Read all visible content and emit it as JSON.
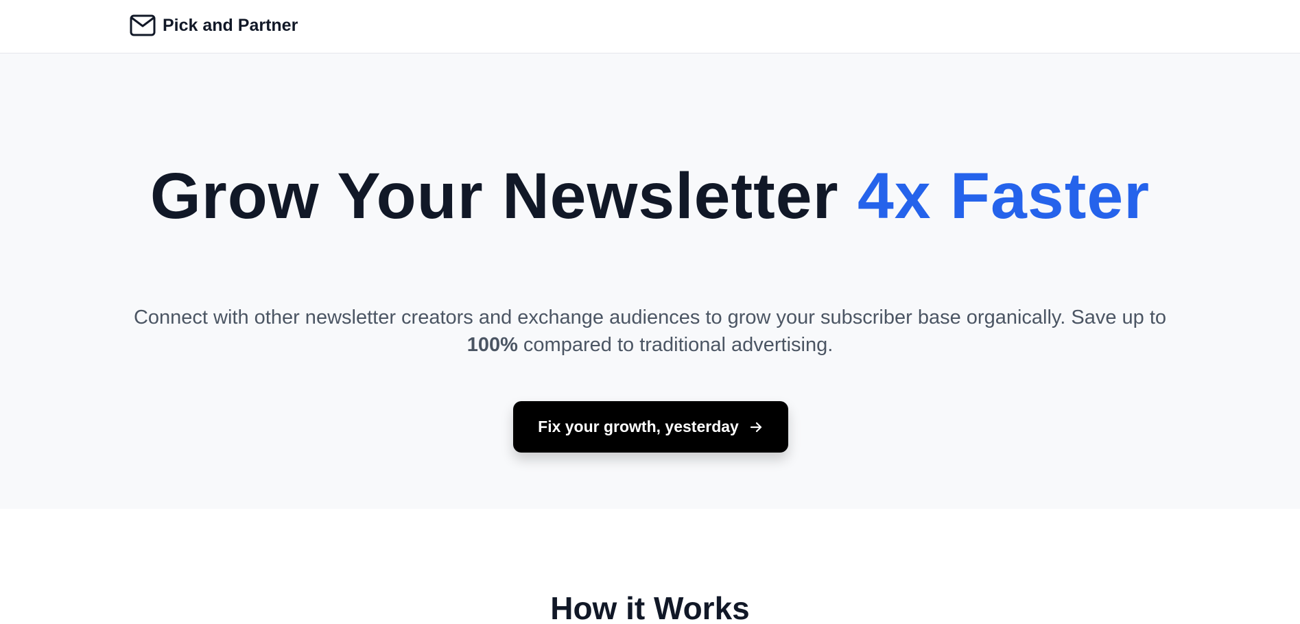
{
  "header": {
    "brand_name": "Pick and Partner",
    "brand_icon": "mail-icon"
  },
  "hero": {
    "title_main": "Grow Your Newsletter ",
    "title_accent": "4x Faster",
    "subtitle_line1": "Connect with other newsletter creators and exchange audiences to grow your subscriber base organically. Save up to",
    "subtitle_bold": "100%",
    "subtitle_line2_rest": " compared to traditional advertising.",
    "cta_label": "Fix your growth, yesterday",
    "cta_icon": "arrow-right-icon"
  },
  "how_it_works": {
    "title": "How it Works"
  },
  "colors": {
    "accent": "#2563eb",
    "text": "#111827",
    "muted": "#4b5563",
    "hero_bg": "#f8f9fb",
    "button_bg": "#000000"
  }
}
